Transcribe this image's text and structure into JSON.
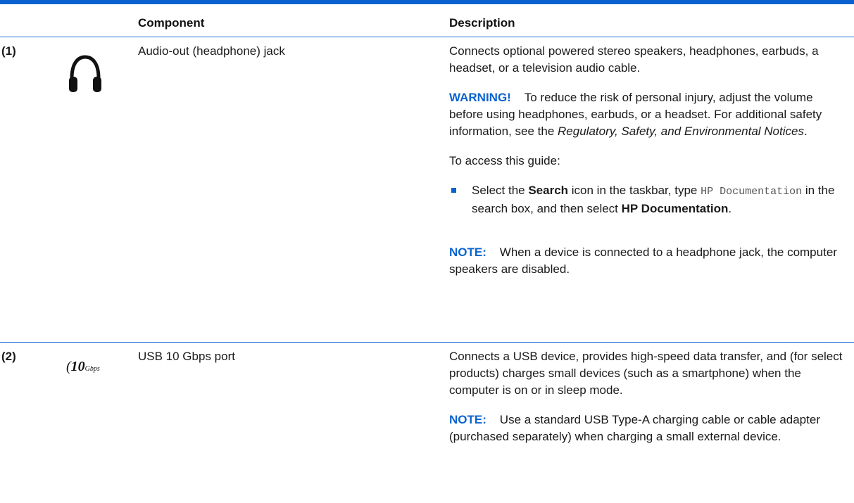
{
  "header": {
    "component": "Component",
    "description": "Description"
  },
  "rows": [
    {
      "number": "(1)",
      "icon": "headphone-icon",
      "component": "Audio-out (headphone) jack",
      "desc_main": "Connects optional powered stereo speakers, headphones, earbuds, a headset, or a television audio cable.",
      "warning_label": "WARNING!",
      "warning_text_1": "To reduce the risk of personal injury, adjust the volume before using headphones, earbuds, or a headset. For additional safety information, see the ",
      "warning_italic": "Regulatory, Safety, and Environmental Notices",
      "warning_text_2": ".",
      "access_text": "To access this guide:",
      "bullet_1": "Select the ",
      "bullet_bold_1": "Search",
      "bullet_2": " icon in the taskbar, type ",
      "bullet_mono": "HP Documentation",
      "bullet_3": " in the search box, and then select ",
      "bullet_bold_2": "HP Documentation",
      "bullet_4": ".",
      "note_label": "NOTE:",
      "note_text": "When a device is connected to a headphone jack, the computer speakers are disabled."
    },
    {
      "number": "(2)",
      "icon": "usb-10gbps-icon",
      "icon_text_main": "10",
      "icon_text_sub": "Gbps",
      "component": "USB 10 Gbps port",
      "desc_main": "Connects a USB device, provides high-speed data transfer, and (for select products) charges small devices (such as a smartphone) when the computer is on or in sleep mode.",
      "note_label": "NOTE:",
      "note_text": "Use a standard USB Type-A charging cable or cable adapter (purchased separately) when charging a small external device."
    }
  ],
  "colors": {
    "accent": "#0a62d0"
  }
}
